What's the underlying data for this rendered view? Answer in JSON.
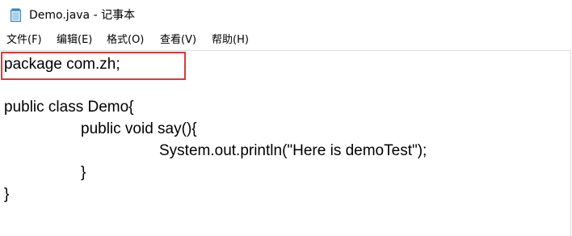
{
  "window": {
    "title": "Demo.java - 记事本",
    "icon": "notepad-icon"
  },
  "menu": {
    "items": [
      {
        "label": "文件(F)"
      },
      {
        "label": "编辑(E)"
      },
      {
        "label": "格式(O)"
      },
      {
        "label": "查看(V)"
      },
      {
        "label": "帮助(H)"
      }
    ]
  },
  "editor": {
    "lines": [
      "package com.zh;",
      "",
      "public class Demo{",
      "public void say(){",
      "System.out.println(\"Here is demoTest\");",
      "}",
      "}"
    ]
  },
  "annotation": {
    "highlight_color": "#d93a3a"
  }
}
